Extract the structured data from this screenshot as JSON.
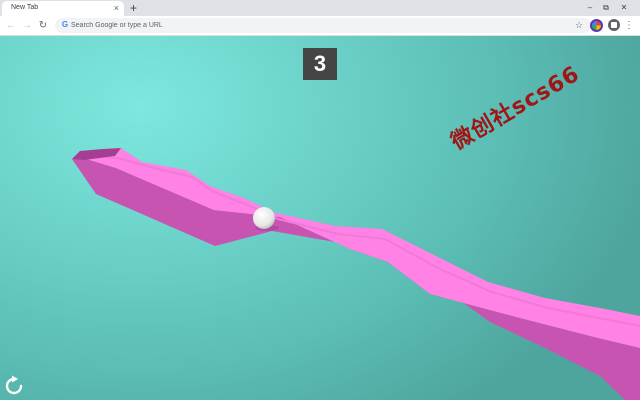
{
  "browser": {
    "tab_title": "New Tab",
    "tab_close_glyph": "×",
    "new_tab_glyph": "+",
    "window_controls": {
      "minimize": "–",
      "restore": "⧉",
      "close": "✕"
    },
    "back_glyph": "←",
    "forward_glyph": "→",
    "reload_glyph": "↻",
    "omnibox_icon": "G",
    "omnibox_placeholder": "Search Google or type a URL",
    "omnibox_value": "",
    "bookmark_glyph": "☆",
    "menu_glyph": "⋮",
    "icons": [
      "google-g-icon",
      "profile-avatar-icon",
      "extensions-puzzle-icon"
    ]
  },
  "game": {
    "score": "3",
    "watermark": "微创社scs66",
    "colors": {
      "background_light": "#7de8df",
      "background_dark": "#4ea59e",
      "track_top": "#ff82e4",
      "track_side": "#c854b2",
      "ball": "#f2f2f2",
      "score_box": "#454545",
      "watermark": "#a01616"
    },
    "icons": [
      "restart-icon"
    ]
  }
}
